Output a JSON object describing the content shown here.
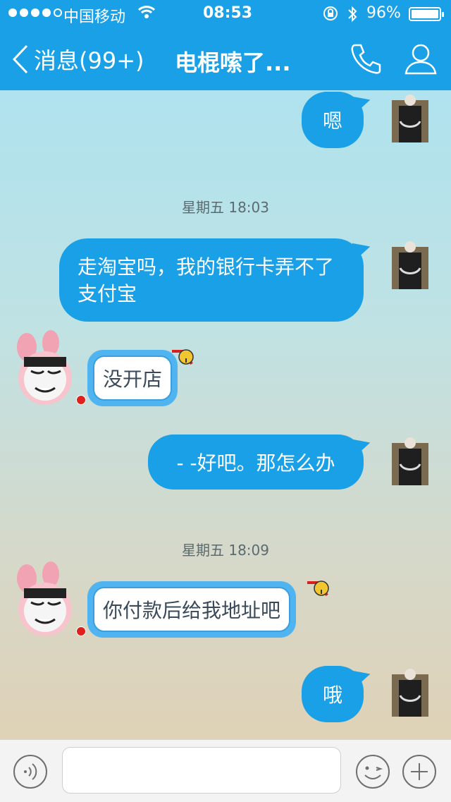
{
  "status_bar": {
    "carrier": "中国移动",
    "time": "08:53",
    "battery_pct": "96%"
  },
  "nav": {
    "back_label": "消息(99+)",
    "title": "电棍嗦了..."
  },
  "messages": [
    {
      "kind": "out",
      "text": "嗯"
    },
    {
      "kind": "timestamp",
      "text": "星期五 18:03"
    },
    {
      "kind": "out",
      "text": "走淘宝吗，我的银行卡弄不了支付宝"
    },
    {
      "kind": "in",
      "text": "没开店"
    },
    {
      "kind": "out",
      "text": "- -好吧。那怎么办"
    },
    {
      "kind": "timestamp",
      "text": "星期五 18:09"
    },
    {
      "kind": "in",
      "text": "你付款后给我地址吧"
    },
    {
      "kind": "out",
      "text": "哦"
    }
  ],
  "input_bar": {
    "placeholder": ""
  },
  "colors": {
    "header": "#1aa0e6",
    "bubble_out": "#1aa0e6",
    "bubble_in": "#4fb4ef"
  }
}
